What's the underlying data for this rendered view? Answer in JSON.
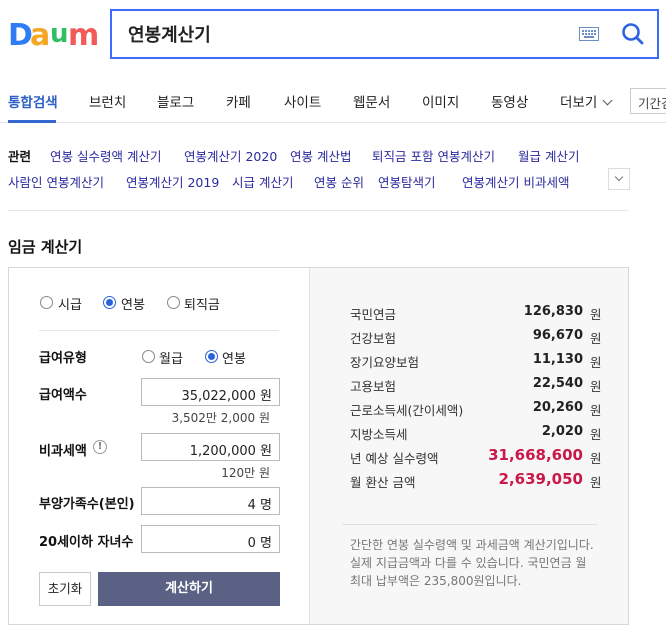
{
  "header": {
    "logo_text": "Daum",
    "search_value": "연봉계산기"
  },
  "tabs": [
    {
      "label": "통합검색",
      "active": true
    },
    {
      "label": "브런치"
    },
    {
      "label": "블로그"
    },
    {
      "label": "카페"
    },
    {
      "label": "사이트"
    },
    {
      "label": "웹문서"
    },
    {
      "label": "이미지"
    },
    {
      "label": "동영상"
    },
    {
      "label": "더보기"
    }
  ],
  "period_label": "기간검색",
  "related": {
    "label": "관련",
    "links": [
      "연봉 실수령액 계산기",
      "연봉계산기 2020",
      "연봉 계산법",
      "퇴직금 포함 연봉계산기",
      "월급 계산기",
      "사람인 연봉계산기",
      "연봉계산기 2019",
      "시급 계산기",
      "연봉 순위",
      "연봉탐색기",
      "연봉계산기 비과세액"
    ]
  },
  "calculator": {
    "title": "임금 계산기",
    "modes": [
      {
        "label": "시급",
        "selected": false
      },
      {
        "label": "연봉",
        "selected": true
      },
      {
        "label": "퇴직금",
        "selected": false
      }
    ],
    "pay_type": {
      "label": "급여유형",
      "options": [
        {
          "label": "월급",
          "selected": false
        },
        {
          "label": "연봉",
          "selected": true
        }
      ]
    },
    "salary": {
      "label": "급여액수",
      "value": "35,022,000 원",
      "hint": "3,502만 2,000 원"
    },
    "nontax": {
      "label": "비과세액",
      "value": "1,200,000 원",
      "hint": "120만 원",
      "info": "!"
    },
    "dependents": {
      "label": "부양가족수(본인)",
      "value": "4 명"
    },
    "children": {
      "label": "20세이하 자녀수",
      "value": "0 명"
    },
    "reset_label": "초기화",
    "calc_label": "계산하기"
  },
  "results": {
    "unit": "원",
    "items": [
      {
        "label": "국민연금",
        "value": "126,830"
      },
      {
        "label": "건강보험",
        "value": "96,670"
      },
      {
        "label": "장기요양보험",
        "value": "11,130"
      },
      {
        "label": "고용보험",
        "value": "22,540"
      },
      {
        "label": "근로소득세(간이세액)",
        "value": "20,260"
      },
      {
        "label": "지방소득세",
        "value": "2,020"
      },
      {
        "label": "년 예상 실수령액",
        "value": "31,668,600",
        "highlight": true
      },
      {
        "label": "월 환산 금액",
        "value": "2,639,050",
        "highlight": true
      }
    ],
    "note": "간단한 연봉 실수령액 및 과세금액 계산기입니다. 실제 지급금액과 다를 수 있습니다. 국민연금 월 최대 납부액은 235,800원입니다."
  },
  "colors": {
    "accent": "#3b6cff",
    "calc_button": "#5b6184",
    "highlight": "#c9184a"
  }
}
